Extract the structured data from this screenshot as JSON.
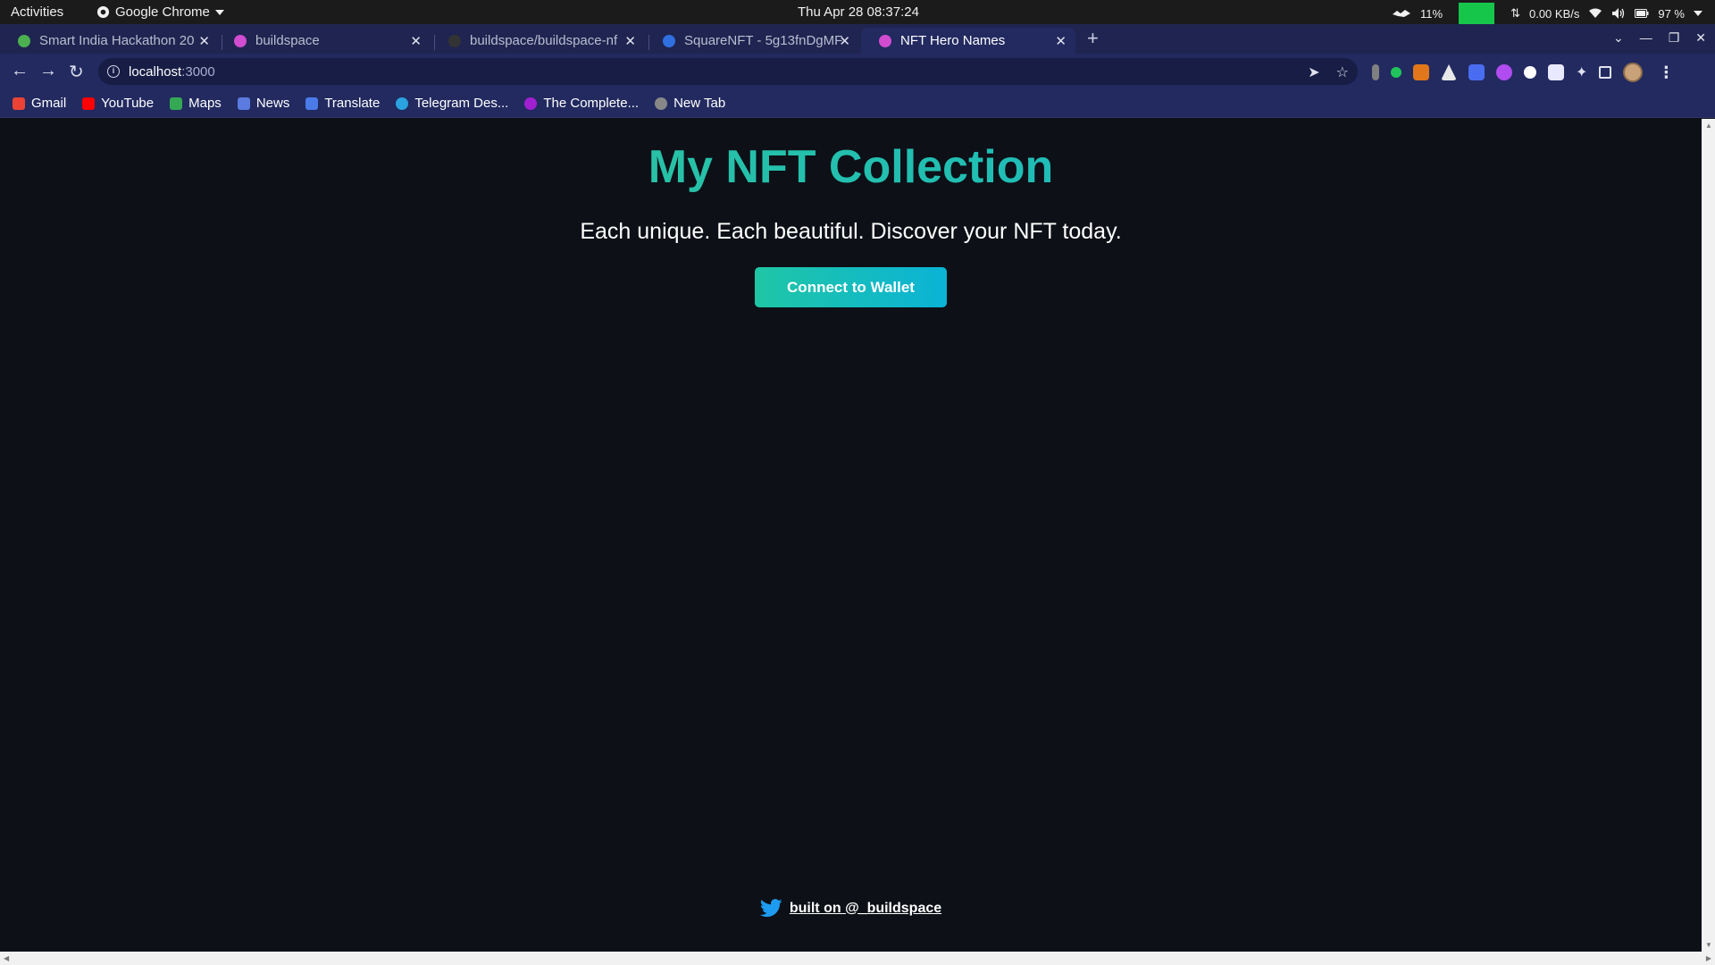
{
  "system": {
    "activities": "Activities",
    "app_name": "Google Chrome",
    "clock": "Thu Apr 28  08:37:24",
    "cpu": "11%",
    "network": "0.00 KB/s",
    "battery": "97 %"
  },
  "tabs": [
    {
      "title": "Smart India Hackathon 20",
      "favicon_color": "#4caf50"
    },
    {
      "title": "buildspace",
      "favicon_color": "#d04cd0"
    },
    {
      "title": "buildspace/buildspace-nf",
      "favicon_color": "#333333"
    },
    {
      "title": "SquareNFT - 5g13fnDgMF",
      "favicon_color": "#2f6fe0"
    },
    {
      "title": "NFT Hero Names",
      "favicon_color": "#d04cd0"
    }
  ],
  "address": {
    "host": "localhost",
    "port": ":3000"
  },
  "bookmarks": [
    {
      "label": "Gmail",
      "color": "#ea4335"
    },
    {
      "label": "YouTube",
      "color": "#ff0000"
    },
    {
      "label": "Maps",
      "color": "#34a853"
    },
    {
      "label": "News",
      "color": "#5b7be0"
    },
    {
      "label": "Translate",
      "color": "#4a7be8"
    },
    {
      "label": "Telegram Des...",
      "color": "#2aa3e0"
    },
    {
      "label": "The Complete...",
      "color": "#a020d0"
    },
    {
      "label": "New Tab",
      "color": "#888888"
    }
  ],
  "page": {
    "title": "My NFT Collection",
    "subtitle": "Each unique. Each beautiful. Discover your NFT today.",
    "connect_button": "Connect to Wallet",
    "footer_link": "built on @_buildspace"
  },
  "colors": {
    "background": "#0d1017",
    "gradient_start": "#35c98d",
    "gradient_end": "#12b5cf",
    "tab_strip": "#1f2550",
    "twitter": "#1d9bf0"
  }
}
